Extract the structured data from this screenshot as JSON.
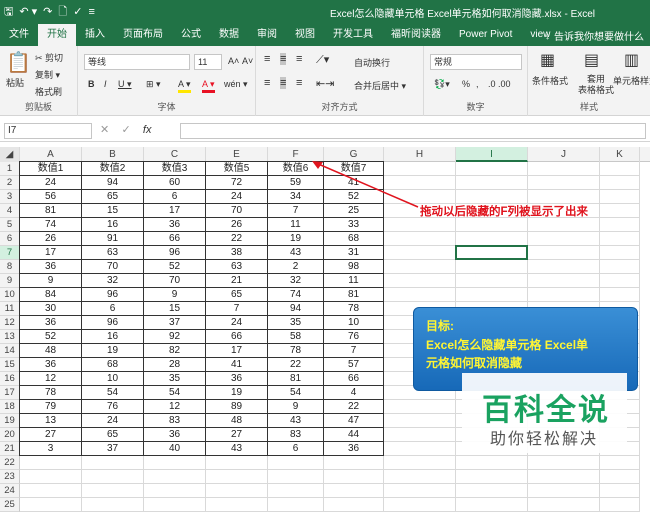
{
  "window": {
    "title": "Excel怎么隐藏单元格 Excel单元格如何取消隐藏.xlsx - Excel"
  },
  "qat": {
    "save_icon": "save-icon",
    "undo_icon": "undo-icon",
    "redo_icon": "redo-icon",
    "preview_icon": "print-preview-icon",
    "spell_icon": "spell-check-icon",
    "more_icon": "customize-icon"
  },
  "tabs": [
    "文件",
    "开始",
    "插入",
    "页面布局",
    "公式",
    "数据",
    "审阅",
    "视图",
    "开发工具",
    "福昕阅读器",
    "Power Pivot",
    "view"
  ],
  "active_tab": "开始",
  "tell_me": "♀ 告诉我你想要做什么",
  "ribbon": {
    "clipboard": {
      "paste": "粘贴",
      "cut": "✂ 剪切",
      "copy": "复制 ▾",
      "format_painter": "格式刷",
      "label": "剪贴板"
    },
    "font": {
      "name": "等线",
      "size": "11",
      "grow": "A˄",
      "shrink": "A˅",
      "bold": "B",
      "italic": "I",
      "underline": "U ▾",
      "border": "⊞ ▾",
      "fill": "A ▾",
      "color": "A ▾",
      "phonetic": "wén ▾",
      "label": "字体"
    },
    "alignment": {
      "wrap": "自动换行",
      "merge": "合并后居中 ▾",
      "label": "对齐方式"
    },
    "number": {
      "format": "常规",
      "percent": "%",
      "comma": ",",
      "label": "数字"
    },
    "styles": {
      "conditional": "条件格式",
      "table": "套用\n表格格式",
      "cell": "单元格样式",
      "label": "样式"
    }
  },
  "formula": {
    "name_box": "I7",
    "cancel": "✕",
    "enter": "✓",
    "fx": "fx",
    "value": ""
  },
  "columns": [
    "A",
    "B",
    "C",
    "D",
    "E",
    "F",
    "G",
    "H",
    "I",
    "J",
    "K"
  ],
  "selected_column": "I",
  "selected_row": 7,
  "rows": [
    "1",
    "2",
    "3",
    "4",
    "5",
    "6",
    "7",
    "8",
    "9",
    "10",
    "11",
    "12",
    "13",
    "14",
    "15",
    "16",
    "17",
    "18",
    "19",
    "20",
    "21",
    "22",
    "23",
    "24",
    "25"
  ],
  "table": {
    "headers": [
      "数值1",
      "数值2",
      "数值3",
      "数值5",
      "数值6",
      "数值7"
    ],
    "header_cols": [
      "A",
      "B",
      "C",
      "E",
      "F",
      "G"
    ],
    "data": [
      [
        "24",
        "94",
        "60",
        "72",
        "59",
        "41"
      ],
      [
        "56",
        "65",
        "6",
        "24",
        "34",
        "52"
      ],
      [
        "81",
        "15",
        "17",
        "70",
        "7",
        "25"
      ],
      [
        "74",
        "16",
        "36",
        "26",
        "11",
        "33"
      ],
      [
        "26",
        "91",
        "66",
        "22",
        "19",
        "68"
      ],
      [
        "17",
        "63",
        "96",
        "38",
        "43",
        "31"
      ],
      [
        "36",
        "70",
        "52",
        "63",
        "2",
        "98"
      ],
      [
        "9",
        "32",
        "70",
        "21",
        "32",
        "11"
      ],
      [
        "84",
        "96",
        "9",
        "65",
        "74",
        "81"
      ],
      [
        "30",
        "6",
        "15",
        "7",
        "94",
        "78"
      ],
      [
        "36",
        "96",
        "37",
        "24",
        "35",
        "10"
      ],
      [
        "52",
        "16",
        "92",
        "66",
        "58",
        "76"
      ],
      [
        "48",
        "19",
        "82",
        "17",
        "78",
        "7"
      ],
      [
        "36",
        "68",
        "28",
        "41",
        "22",
        "57"
      ],
      [
        "12",
        "10",
        "35",
        "36",
        "81",
        "66"
      ],
      [
        "78",
        "54",
        "54",
        "19",
        "54",
        "4"
      ],
      [
        "79",
        "76",
        "12",
        "89",
        "9",
        "22"
      ],
      [
        "13",
        "24",
        "83",
        "48",
        "43",
        "47"
      ],
      [
        "27",
        "65",
        "36",
        "27",
        "83",
        "44"
      ],
      [
        "3",
        "37",
        "40",
        "43",
        "6",
        "36"
      ]
    ]
  },
  "annotation": "拖动以后隐藏的F列被显示了出来",
  "annotation_color": "#e0141e",
  "goal": {
    "title": "目标:",
    "line1": "Excel怎么隐藏单元格 Excel单",
    "line2": "元格如何取消隐藏"
  },
  "watermark": {
    "big": "百科全说",
    "small": "助你轻松解决"
  },
  "colors": {
    "excel_green": "#217346",
    "goal_text": "#fff533",
    "watermark_green": "#1aa260"
  }
}
